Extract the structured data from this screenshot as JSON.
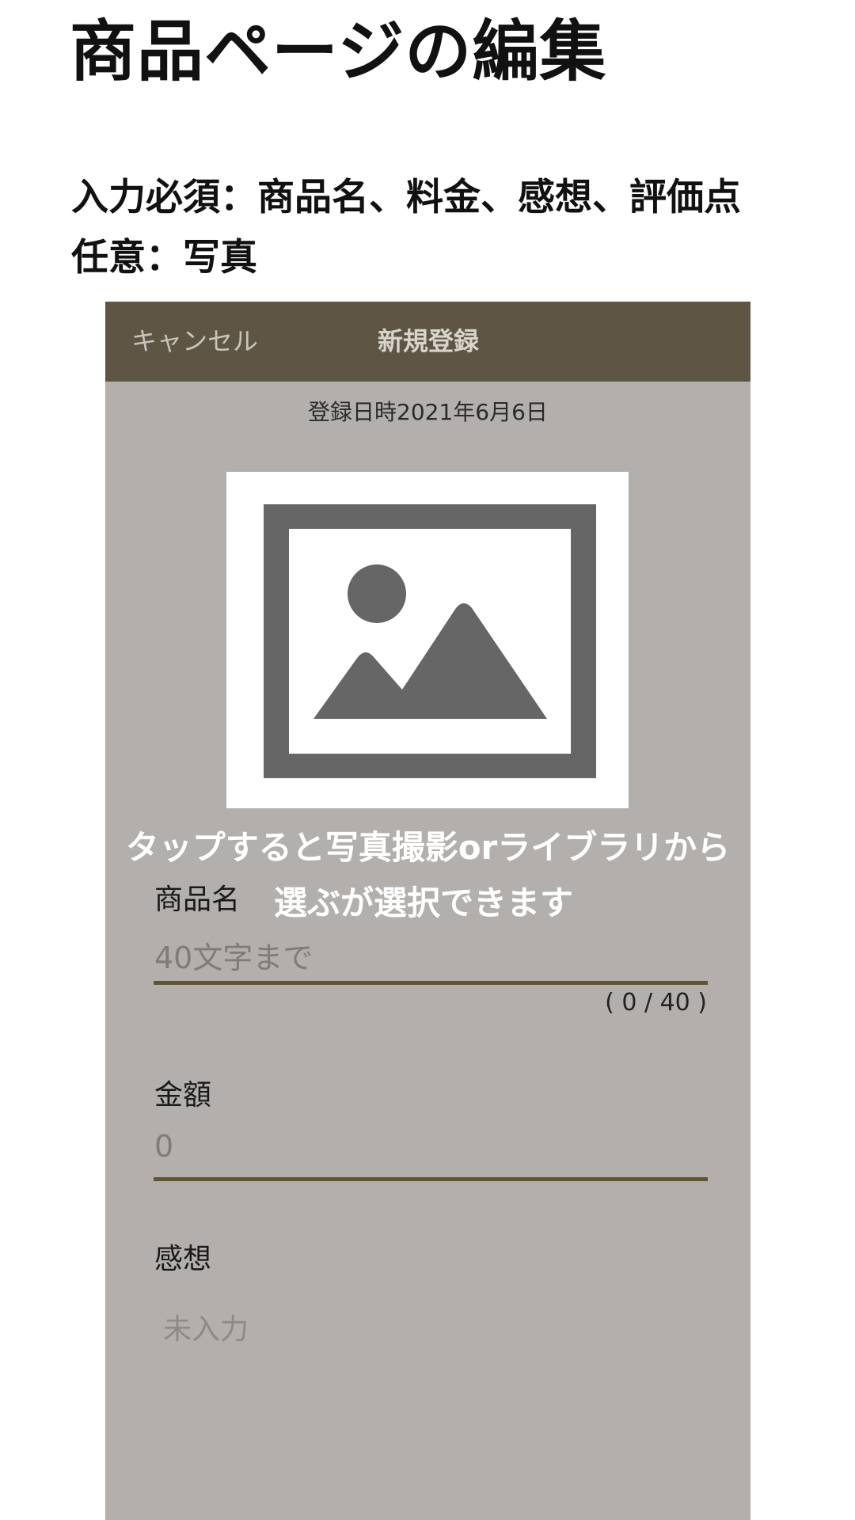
{
  "page": {
    "title": "商品ページの編集",
    "required_note": "入力必須：商品名、料金、感想、評価点",
    "optional_note": "任意：写真"
  },
  "navbar": {
    "cancel_label": "キャンセル",
    "title": "新規登録",
    "background": "#5f5545"
  },
  "form": {
    "registration_date": "登録日時2021年6月6日",
    "photo": {
      "icon": "image-placeholder-icon",
      "annotation_line1": "タップすると写真撮影orライブラリから",
      "annotation_line2": "選ぶが選択できます"
    },
    "product_name": {
      "label": "商品名",
      "placeholder": "40文字まで",
      "counter": "( 0 / 40 )"
    },
    "price": {
      "label": "金額",
      "placeholder": "0"
    },
    "impression": {
      "label": "感想",
      "placeholder": "未入力"
    }
  },
  "colors": {
    "form_background": "#b3afac",
    "underline": "#5e5537",
    "icon_gray": "#666666"
  }
}
